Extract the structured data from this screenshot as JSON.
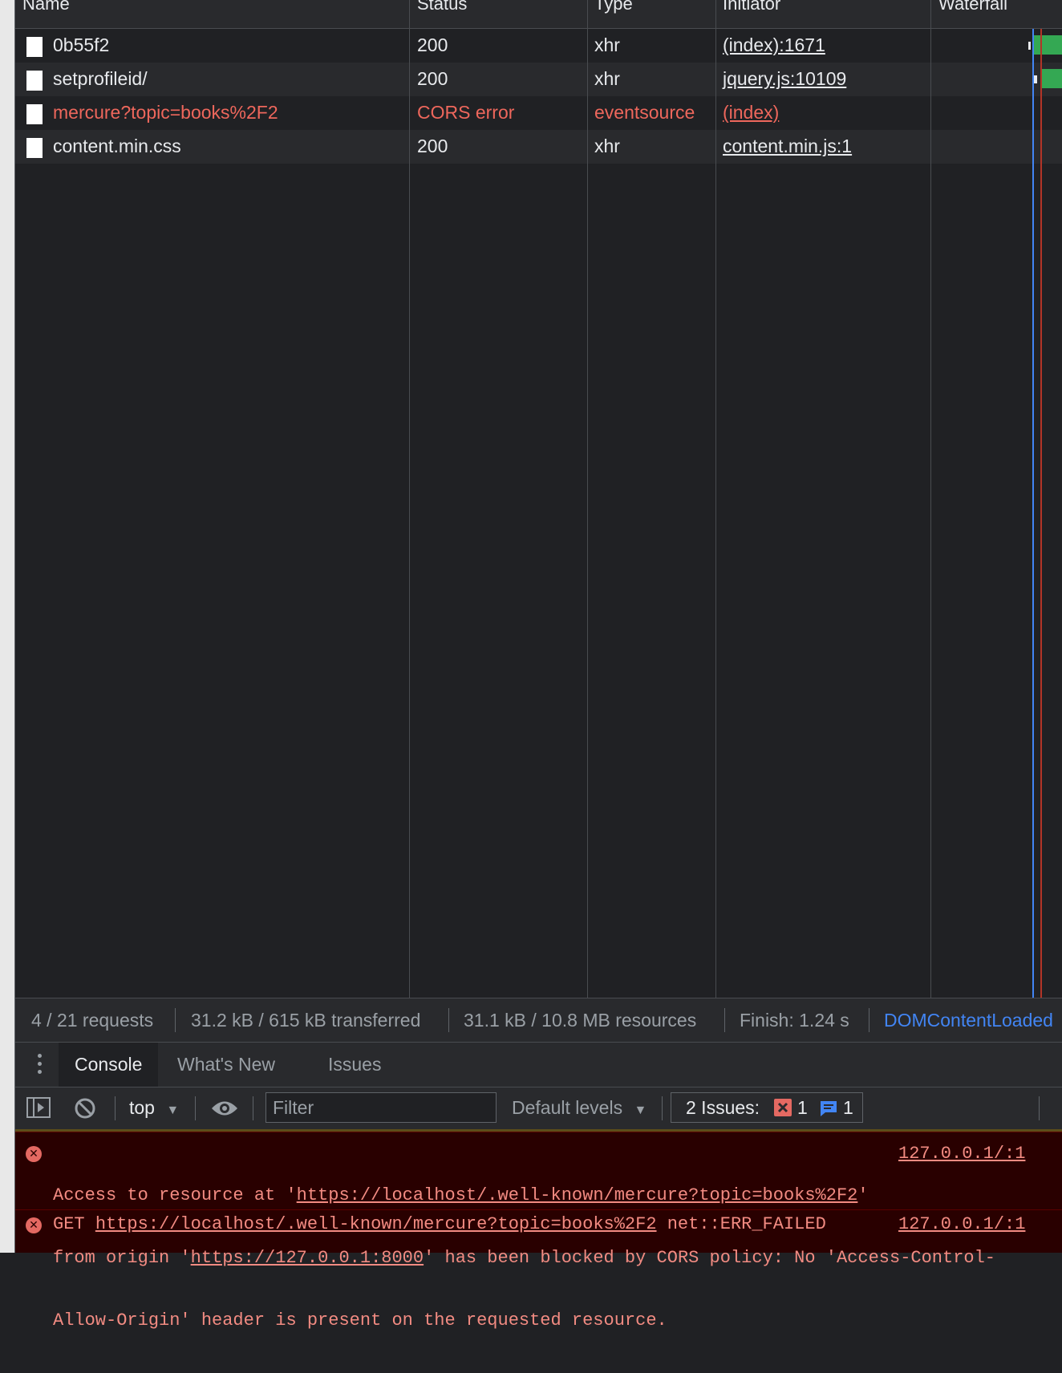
{
  "columns": {
    "name": "Name",
    "status": "Status",
    "type": "Type",
    "initiator": "Initiator",
    "waterfall": "Waterfall"
  },
  "requests": [
    {
      "name": "0b55f2",
      "status": "200",
      "type": "xhr",
      "initiator": "(index):1671",
      "error": false
    },
    {
      "name": "setprofileid/",
      "status": "200",
      "type": "xhr",
      "initiator": "jquery.js:10109",
      "error": false
    },
    {
      "name": "mercure?topic=books%2F2",
      "status": "CORS error",
      "type": "eventsource",
      "initiator": "(index)",
      "error": true
    },
    {
      "name": "content.min.css",
      "status": "200",
      "type": "xhr",
      "initiator": "content.min.js:1",
      "error": false
    }
  ],
  "summary": {
    "requests": "4 / 21 requests",
    "transferred": "31.2 kB / 615 kB transferred",
    "resources": "31.1 kB / 10.8 MB resources",
    "finish": "Finish: 1.24 s",
    "dom_content_loaded": "DOMContentLoaded"
  },
  "drawer_tabs": {
    "console": "Console",
    "whats_new": "What's New",
    "issues": "Issues"
  },
  "toolbar": {
    "context": "top",
    "filter_placeholder": "Filter",
    "levels": "Default levels",
    "issues_label": "2 Issues:",
    "error_count": "1",
    "info_count": "1"
  },
  "console_messages": [
    {
      "part1": "Access to resource at '",
      "url": "https://localhost/.well-known/mercure?topic=books%2F2",
      "part2": "'",
      "line2_pre": "from origin '",
      "origin": "https://127.0.0.1:8000",
      "line2_post": "' has been blocked by CORS policy: No 'Access-Control-",
      "line3": "Allow-Origin' header is present on the requested resource.",
      "source": "127.0.0.1/:1"
    },
    {
      "method": "GET ",
      "url": "https://localhost/.well-known/mercure?topic=books%2F2",
      "suffix": " net::ERR_FAILED",
      "source": "127.0.0.1/:1"
    }
  ],
  "colors": {
    "error_text": "#ee675c",
    "link_blue": "#4285f4",
    "bar_green": "#34a853"
  }
}
